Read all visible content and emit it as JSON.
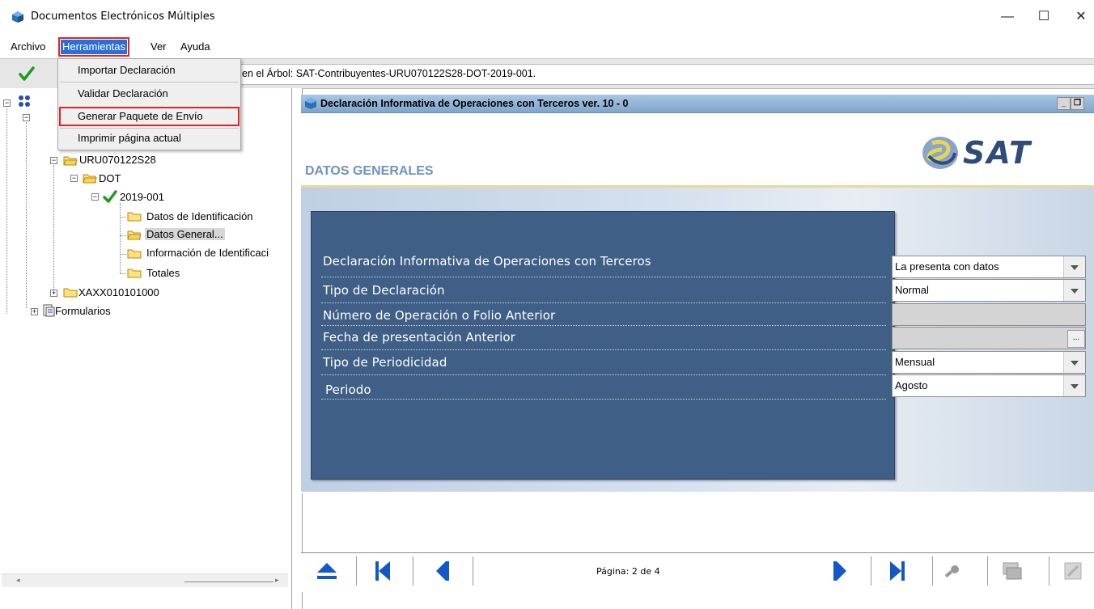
{
  "window": {
    "title": "Documentos Electrónicos Múltiples",
    "minimize": "—",
    "maximize": "☐",
    "close": "✕"
  },
  "menubar": {
    "items": [
      "Archivo",
      "Herramientas",
      "Ver",
      "Ayuda"
    ]
  },
  "dropdown": {
    "items": [
      "Importar Declaración",
      "Validar Declaración",
      "Generar Paquete de Envío",
      "Imprimir página actual"
    ]
  },
  "toolbar": {
    "path": "en el Árbol: SAT-Contribuyentes-URU070122S28-DOT-2019-001."
  },
  "tree": {
    "nodes": {
      "rfc": "URU070122S28",
      "dot": "DOT",
      "period": "2019-001",
      "datos_ident": "Datos de Identificación",
      "datos_gen": "Datos General...",
      "info_ident": "Información de Identificaci",
      "totales": "Totales",
      "xaxx": "XAXX010101000",
      "formularios": "Formularios"
    }
  },
  "frame": {
    "title": "Declaración Informativa de Operaciones con Terceros ver. 10 - 0",
    "section_title": "DATOS GENERALES",
    "logo_text": "SAT",
    "min_btn": "_",
    "restore_btn": "❐"
  },
  "form": {
    "rows": [
      {
        "label": "Declaración Informativa de Operaciones con Terceros",
        "value": "La presenta con datos"
      },
      {
        "label": "Tipo de Declaración",
        "value": "Normal"
      },
      {
        "label": "Número de Operación o Folio Anterior",
        "value": ""
      },
      {
        "label": "Fecha de presentación Anterior",
        "value": ""
      },
      {
        "label": "Tipo de Periodicidad",
        "value": "Mensual"
      },
      {
        "label": "Periodo",
        "value": "Agosto"
      }
    ],
    "date_button": "..."
  },
  "nav": {
    "page_text": "Página: 2  de  4"
  },
  "colors": {
    "menu_highlight": "#2a6fd6",
    "callout_red": "#e02424",
    "panel_blue": "#3f5f87",
    "section_title": "#6e93bf"
  }
}
